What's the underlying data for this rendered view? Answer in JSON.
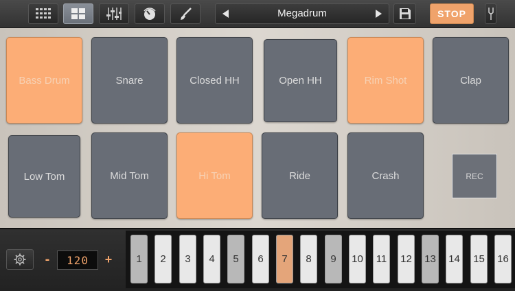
{
  "toolbar": {
    "preset_name": "Megadrum",
    "stop_label": "STOP",
    "buttons": [
      {
        "name": "grid-view-icon",
        "active": false
      },
      {
        "name": "pads-view-icon",
        "active": true
      },
      {
        "name": "mixer-icon",
        "active": false
      },
      {
        "name": "knob-icon",
        "active": false
      },
      {
        "name": "brush-icon",
        "active": false
      }
    ]
  },
  "pads": [
    {
      "label": "Bass Drum",
      "on": true
    },
    {
      "label": "Snare",
      "on": false
    },
    {
      "label": "Closed HH",
      "on": false
    },
    {
      "label": "Open HH",
      "on": false
    },
    {
      "label": "Rim Shot",
      "on": true
    },
    {
      "label": "Clap",
      "on": false
    },
    {
      "label": "Low Tom",
      "on": false
    },
    {
      "label": "Mid Tom",
      "on": false
    },
    {
      "label": "Hi Tom",
      "on": true
    },
    {
      "label": "Ride",
      "on": false
    },
    {
      "label": "Crash",
      "on": false
    }
  ],
  "rec_label": "REC",
  "tempo": {
    "value": "120",
    "minus_label": "-",
    "plus_label": "+"
  },
  "steps": [
    {
      "label": "1",
      "state": "grey"
    },
    {
      "label": "2",
      "state": "white"
    },
    {
      "label": "3",
      "state": "white"
    },
    {
      "label": "4",
      "state": "white"
    },
    {
      "label": "5",
      "state": "grey"
    },
    {
      "label": "6",
      "state": "white"
    },
    {
      "label": "7",
      "state": "active"
    },
    {
      "label": "8",
      "state": "white"
    },
    {
      "label": "9",
      "state": "grey"
    },
    {
      "label": "10",
      "state": "white"
    },
    {
      "label": "11",
      "state": "white"
    },
    {
      "label": "12",
      "state": "white"
    },
    {
      "label": "13",
      "state": "grey"
    },
    {
      "label": "14",
      "state": "white"
    },
    {
      "label": "15",
      "state": "white"
    },
    {
      "label": "16",
      "state": "white"
    }
  ],
  "colors": {
    "accent": "#f0a36b",
    "pad_on": "#fcad76",
    "pad_off": "#686d76"
  }
}
